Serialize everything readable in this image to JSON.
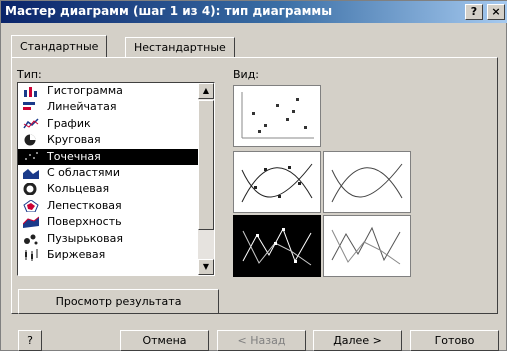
{
  "window": {
    "title": "Мастер диаграмм (шаг 1 из 4): тип диаграммы",
    "help_glyph": "?",
    "close_glyph": "×"
  },
  "tabs": [
    {
      "label": "Стандартные",
      "selected": true
    },
    {
      "label": "Нестандартные",
      "selected": false
    }
  ],
  "type_label": "Тип:",
  "view_label": "Вид:",
  "chart_types": [
    {
      "label": "Гистограмма",
      "icon": "column-chart-icon"
    },
    {
      "label": "Линейчатая",
      "icon": "bar-chart-icon"
    },
    {
      "label": "График",
      "icon": "line-chart-icon"
    },
    {
      "label": "Круговая",
      "icon": "pie-chart-icon"
    },
    {
      "label": "Точечная",
      "icon": "scatter-chart-icon",
      "selected": true
    },
    {
      "label": "С областями",
      "icon": "area-chart-icon"
    },
    {
      "label": "Кольцевая",
      "icon": "doughnut-chart-icon"
    },
    {
      "label": "Лепестковая",
      "icon": "radar-chart-icon"
    },
    {
      "label": "Поверхность",
      "icon": "surface-chart-icon"
    },
    {
      "label": "Пузырьковая",
      "icon": "bubble-chart-icon"
    },
    {
      "label": "Биржевая",
      "icon": "stock-chart-icon"
    }
  ],
  "subtypes": [
    {
      "name": "scatter-markers-only",
      "selected": false
    },
    {
      "name": "scatter-smooth-lines-markers",
      "selected": false
    },
    {
      "name": "scatter-smooth-lines",
      "selected": false
    },
    {
      "name": "scatter-straight-lines-markers",
      "selected": true
    },
    {
      "name": "scatter-straight-lines",
      "selected": false
    }
  ],
  "preview_button": "Просмотр результата",
  "buttons": {
    "help": "?",
    "cancel": "Отмена",
    "back": "< Назад",
    "next": "Далее >",
    "finish": "Готово"
  },
  "colors": {
    "title_start": "#0a246a",
    "title_end": "#a6caf0",
    "face": "#d4d0c8",
    "selection": "#000000"
  }
}
